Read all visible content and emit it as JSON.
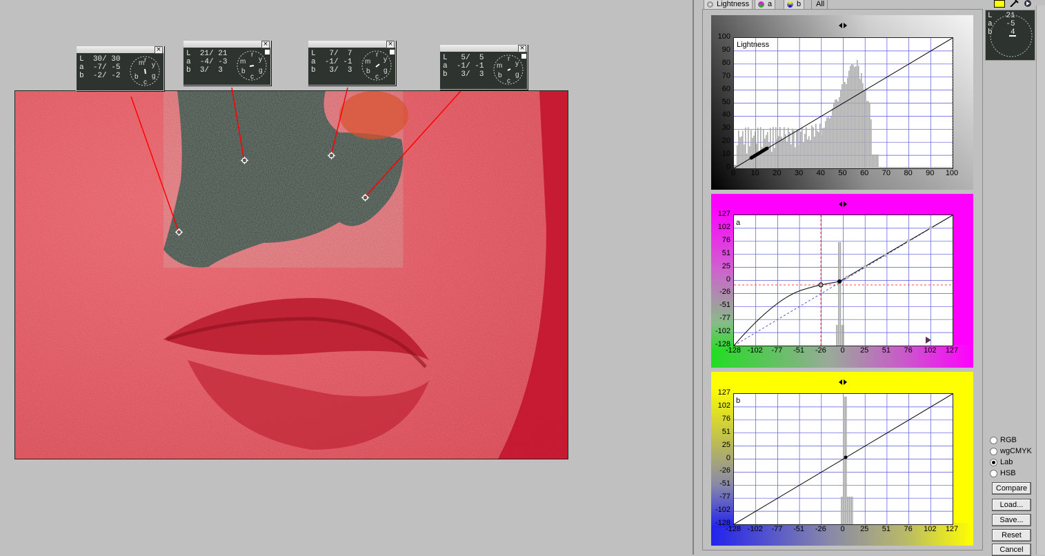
{
  "samplers": [
    {
      "L": "30/ 30",
      "a": "-7/ -5",
      "b": "-2/ -2"
    },
    {
      "L": "21/ 21",
      "a": "-4/ -3",
      "b": "3/  3"
    },
    {
      "L": "7/  7",
      "a": "-1/ -1",
      "b": "3/  3"
    },
    {
      "L": "5/  5",
      "a": "-1/ -1",
      "b": "3/  3"
    }
  ],
  "sampler_labels": {
    "L": "L",
    "a": "a",
    "b": "b",
    "close": "×"
  },
  "dial_letters": {
    "m": "m",
    "r": "r",
    "y": "y",
    "g": "g",
    "c": "c",
    "b": "b"
  },
  "tabs": [
    "Lightness",
    "a",
    "b",
    "All"
  ],
  "info_panel": {
    "L_label": "L",
    "L_value": "21",
    "a_label": "a",
    "a_value": "-5",
    "b_label": "b",
    "b_value": "4"
  },
  "graphs": {
    "lightness": {
      "name": "Lightness",
      "y_ticks": [
        "100",
        "90",
        "80",
        "70",
        "60",
        "50",
        "40",
        "30",
        "20",
        "10",
        "0"
      ],
      "x_ticks": [
        "0",
        "10",
        "20",
        "30",
        "40",
        "50",
        "60",
        "70",
        "80",
        "90",
        "100"
      ]
    },
    "a": {
      "name": "a",
      "y_ticks": [
        "127",
        "102",
        "76",
        "51",
        "25",
        "0",
        "-26",
        "-51",
        "-77",
        "-102",
        "-128"
      ],
      "x_ticks": [
        "-128",
        "-102",
        "-77",
        "-51",
        "-26",
        "0",
        "25",
        "51",
        "76",
        "102",
        "127"
      ]
    },
    "b": {
      "name": "b",
      "y_ticks": [
        "127",
        "102",
        "76",
        "51",
        "25",
        "0",
        "-26",
        "-51",
        "-77",
        "-102",
        "-128"
      ],
      "x_ticks": [
        "-128",
        "-102",
        "-77",
        "-51",
        "-26",
        "0",
        "25",
        "51",
        "76",
        "102",
        "127"
      ]
    }
  },
  "color_modes": [
    {
      "label": "RGB",
      "selected": false
    },
    {
      "label": "wgCMYK",
      "selected": false
    },
    {
      "label": "Lab",
      "selected": true
    },
    {
      "label": "HSB",
      "selected": false
    }
  ],
  "buttons": {
    "compare": "Compare",
    "load": "Load...",
    "save": "Save...",
    "reset": "Reset",
    "cancel": "Cancel"
  },
  "colors": {
    "image_red": "#d9464f",
    "a_frame": "#ff00ff",
    "b_frame": "#ffff00",
    "grid": "#5555dd"
  }
}
